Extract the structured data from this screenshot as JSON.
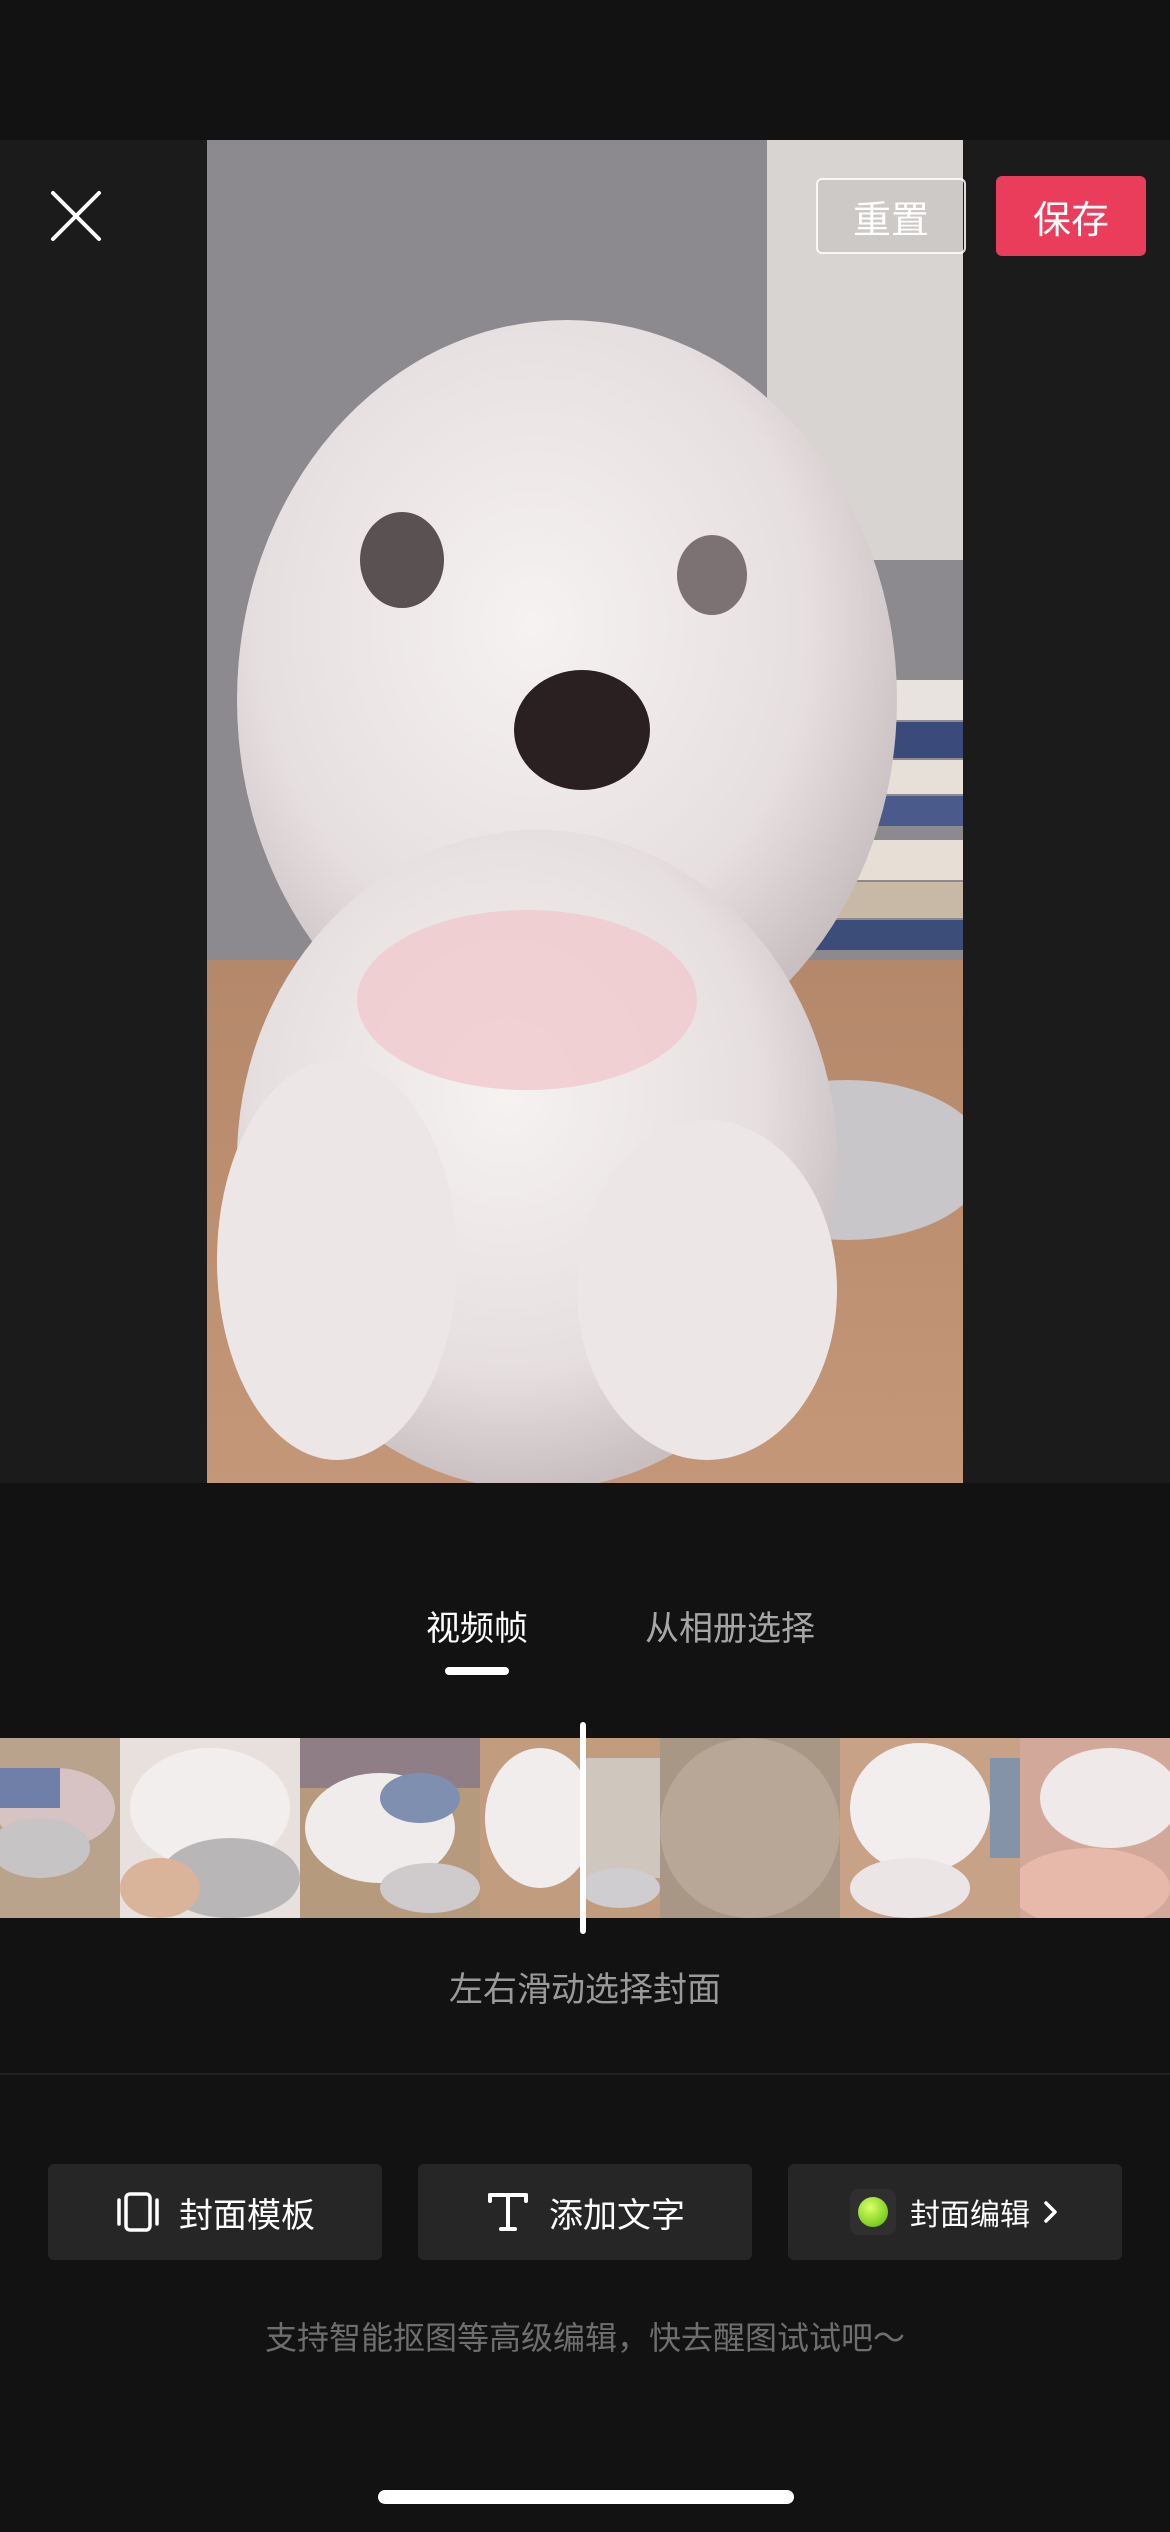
{
  "toolbar": {
    "close_icon": "close-icon",
    "reset_label": "重置",
    "save_label": "保存"
  },
  "tabs": [
    {
      "label": "视频帧",
      "selected": true
    },
    {
      "label": "从相册选择",
      "selected": false
    }
  ],
  "filmstrip": {
    "frame_count": 7
  },
  "hint": "左右滑动选择封面",
  "tools": [
    {
      "label": "封面模板",
      "icon": "template-icon"
    },
    {
      "label": "添加文字",
      "icon": "text-icon"
    },
    {
      "label": "封面编辑",
      "icon": "app-badge-icon",
      "trailing_icon": "chevron-right-icon"
    }
  ],
  "promo": "支持智能抠图等高级编辑，快去醒图试试吧～",
  "colors": {
    "accent": "#ea3d5c",
    "background": "#121212"
  }
}
